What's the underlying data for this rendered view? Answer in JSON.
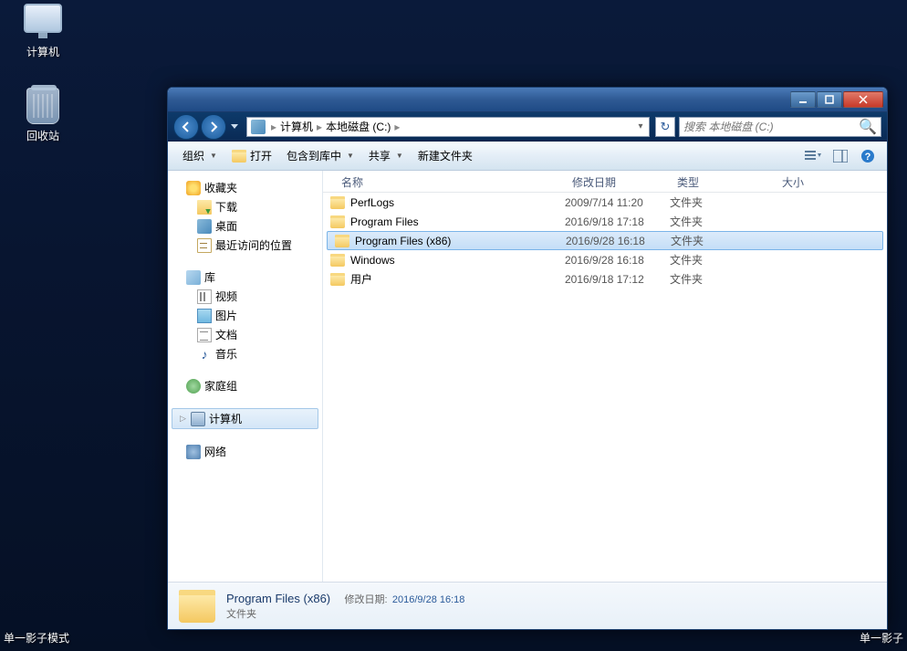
{
  "desktop": {
    "computer": "计算机",
    "recycle": "回收站"
  },
  "breadcrumb": {
    "root": "计算机",
    "drive": "本地磁盘 (C:)"
  },
  "search": {
    "placeholder": "搜索 本地磁盘 (C:)"
  },
  "toolbar": {
    "organize": "组织",
    "open": "打开",
    "include": "包含到库中",
    "share": "共享",
    "newfolder": "新建文件夹"
  },
  "sidebar": {
    "favorites": "收藏夹",
    "downloads": "下载",
    "desktop": "桌面",
    "recent": "最近访问的位置",
    "libraries": "库",
    "videos": "视频",
    "pictures": "图片",
    "documents": "文档",
    "music": "音乐",
    "homegroup": "家庭组",
    "computer": "计算机",
    "network": "网络"
  },
  "columns": {
    "name": "名称",
    "date": "修改日期",
    "type": "类型",
    "size": "大小"
  },
  "files": [
    {
      "name": "PerfLogs",
      "date": "2009/7/14 11:20",
      "type": "文件夹",
      "selected": false
    },
    {
      "name": "Program Files",
      "date": "2016/9/18 17:18",
      "type": "文件夹",
      "selected": false
    },
    {
      "name": "Program Files (x86)",
      "date": "2016/9/28 16:18",
      "type": "文件夹",
      "selected": true
    },
    {
      "name": "Windows",
      "date": "2016/9/28 16:18",
      "type": "文件夹",
      "selected": false
    },
    {
      "name": "用户",
      "date": "2016/9/18 17:12",
      "type": "文件夹",
      "selected": false
    }
  ],
  "details": {
    "name": "Program Files (x86)",
    "type": "文件夹",
    "modlabel": "修改日期:",
    "moddate": "2016/9/28 16:18"
  },
  "bottom": {
    "left": "单一影子模式",
    "right": "单一影子"
  }
}
